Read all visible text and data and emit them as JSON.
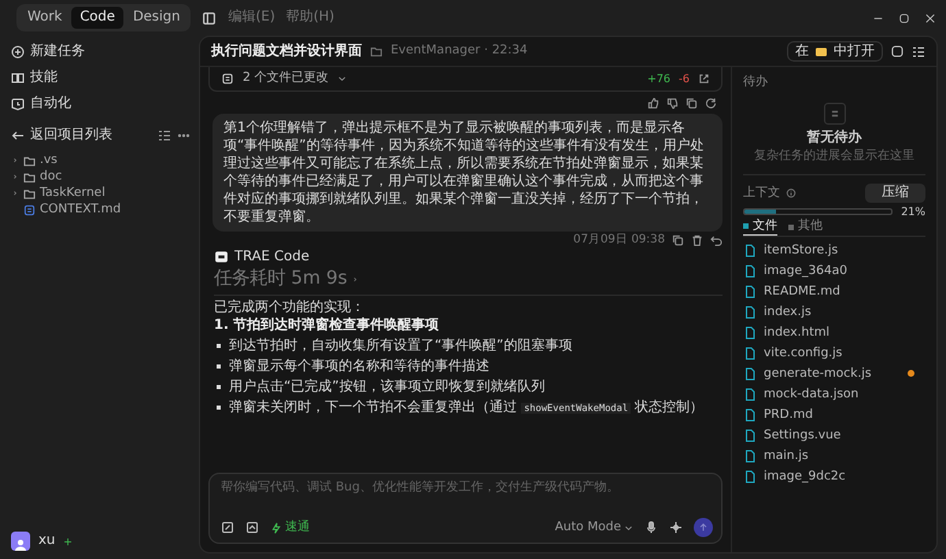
{
  "mode_tabs": [
    {
      "label": "Work",
      "selected": false
    },
    {
      "label": "Code",
      "selected": true
    },
    {
      "label": "Design",
      "selected": false
    }
  ],
  "menu": [
    "编辑(E)",
    "帮助(H)"
  ],
  "sidebar": {
    "items": [
      "新建任务",
      "技能",
      "自动化"
    ],
    "back": "返回项目列表",
    "tree": [
      {
        "name": ".vs",
        "kind": "folder"
      },
      {
        "name": "doc",
        "kind": "folder"
      },
      {
        "name": "TaskKernel",
        "kind": "folder"
      },
      {
        "name": "CONTEXT.md",
        "kind": "file"
      }
    ],
    "user": "xu"
  },
  "header": {
    "title": "执行问题文档并设计界面",
    "project": "EventManager · 22:34",
    "open_prefix": "在",
    "open_suffix": "中打开"
  },
  "chat": {
    "changes": {
      "label": "2 个文件已更改",
      "added": "+76",
      "removed": "-6"
    },
    "user_message": "第1个你理解错了，弹出提示框不是为了显示被唤醒的事项列表，而是显示各项“事件唤醒”的等待事件，因为系统不知道等待的这些事件有没有发生，用户处理过这些事件又可能忘了在系统上点，所以需要系统在节拍处弹窗显示，如果某个等待的事件已经满足了，用户可以在弹窗里确认这个事件完成，从而把这个事件对应的事项挪到就绪队列里。如果某个弹窗一直没关掉，经历了下一个节拍，不要重复弹窗。",
    "timestamp": "07月09日 09:38",
    "agent": "TRAE Code",
    "duration": "任务耗时 5m 9s",
    "intro": "已完成两个功能的实现：",
    "heading": "1. 节拍到达时弹窗检查事件唤醒事项",
    "bullets": [
      {
        "text": "到达节拍时，自动收集所有设置了“事件唤醒”的阻塞事项"
      },
      {
        "text": "弹窗显示每个事项的名称和等待的事件描述"
      },
      {
        "text": "用户点击“已完成”按钮，该事项立即恢复到就绪队列"
      },
      {
        "text": "弹窗未关闭时，下一个节拍不会重复弹出（通过",
        "code": "showEventWakeModal",
        "after": "状态控制）"
      }
    ],
    "input": {
      "placeholder": "帮你编写代码、调试 Bug、优化性能等开发工作，交付生产级代码产物。",
      "speed": "速通",
      "mode": "Auto Mode"
    }
  },
  "todo": {
    "title": "待办",
    "empty_title": "暂无待办",
    "empty_hint": "复杂任务的进展会显示在这里"
  },
  "context": {
    "title": "上下文",
    "compress": "压缩",
    "level": 0.21,
    "percent": "21%",
    "tabs": [
      {
        "label": "文件",
        "selected": true
      },
      {
        "label": "其他",
        "selected": false
      }
    ],
    "files": [
      {
        "name": "itemStore.js",
        "badge": false
      },
      {
        "name": "image_364a0",
        "badge": false
      },
      {
        "name": "README.md",
        "badge": false
      },
      {
        "name": "index.js",
        "badge": false
      },
      {
        "name": "index.html",
        "badge": false
      },
      {
        "name": "vite.config.js",
        "badge": false
      },
      {
        "name": "generate-mock.js",
        "badge": true
      },
      {
        "name": "mock-data.json",
        "badge": false
      },
      {
        "name": "PRD.md",
        "badge": false
      },
      {
        "name": "Settings.vue",
        "badge": false
      },
      {
        "name": "main.js",
        "badge": false
      },
      {
        "name": "image_9dc2c",
        "badge": false
      }
    ]
  }
}
